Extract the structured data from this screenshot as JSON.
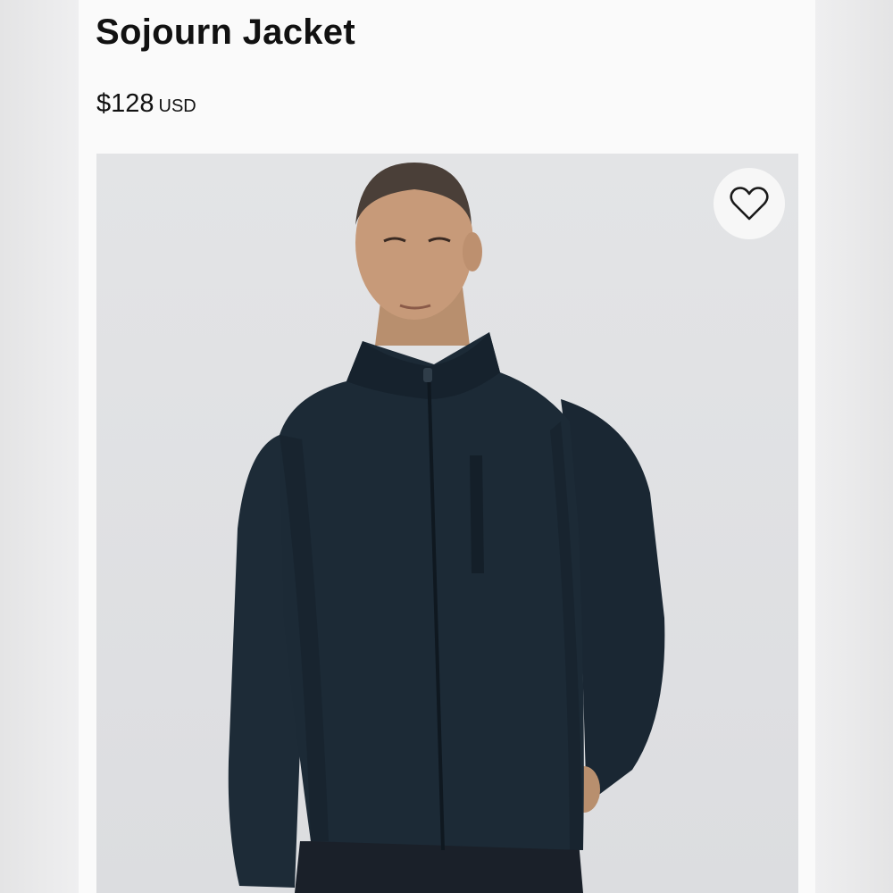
{
  "product": {
    "title": "Sojourn Jacket",
    "price": {
      "amount": "$128",
      "currency": "USD"
    }
  },
  "image": {
    "subject": "model-wearing-navy-full-zip-jacket",
    "jacket_color": "#1c2a36",
    "background_color": "#dedfe2"
  },
  "wishlist": {
    "icon": "heart-outline-icon"
  }
}
